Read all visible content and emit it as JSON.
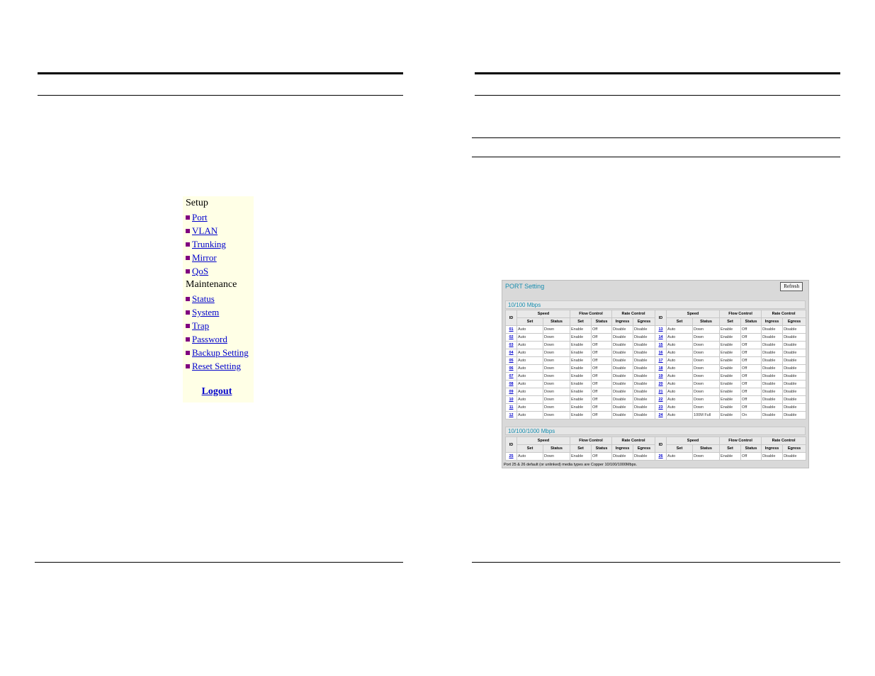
{
  "sidebar": {
    "setup_heading": "Setup",
    "setup_items": [
      {
        "label": "Port"
      },
      {
        "label": "VLAN"
      },
      {
        "label": "Trunking"
      },
      {
        "label": "Mirror"
      },
      {
        "label": "QoS"
      }
    ],
    "maintenance_heading": "Maintenance",
    "maintenance_items": [
      {
        "label": "Status"
      },
      {
        "label": "System"
      },
      {
        "label": "Trap"
      },
      {
        "label": "Password"
      },
      {
        "label": "Backup Setting"
      },
      {
        "label": "Reset Setting"
      }
    ],
    "logout_label": "Logout",
    "bullet_color": "#800080",
    "link_color": "#0000cc",
    "background_color": "#ffffe6"
  },
  "port_setting": {
    "title": "PORT Setting",
    "refresh_label": "Refresh",
    "section_fast": "10/100 Mbps",
    "section_giga": "10/100/1000 Mbps",
    "headers": {
      "id": "ID",
      "speed": "Speed",
      "flow_control": "Flow Control",
      "rate_control": "Rate Control",
      "set": "Set",
      "status": "Status",
      "ingress": "Ingress",
      "egress": "Egress"
    },
    "fast_rows": [
      [
        {
          "id": "01",
          "speed_set": "Auto",
          "speed_status": "Down",
          "flow_set": "Enable",
          "flow_status": "Off",
          "ingress": "Disable",
          "egress": "Disable"
        },
        {
          "id": "13",
          "speed_set": "Auto",
          "speed_status": "Down",
          "flow_set": "Enable",
          "flow_status": "Off",
          "ingress": "Disable",
          "egress": "Disable"
        }
      ],
      [
        {
          "id": "02",
          "speed_set": "Auto",
          "speed_status": "Down",
          "flow_set": "Enable",
          "flow_status": "Off",
          "ingress": "Disable",
          "egress": "Disable"
        },
        {
          "id": "14",
          "speed_set": "Auto",
          "speed_status": "Down",
          "flow_set": "Enable",
          "flow_status": "Off",
          "ingress": "Disable",
          "egress": "Disable"
        }
      ],
      [
        {
          "id": "03",
          "speed_set": "Auto",
          "speed_status": "Down",
          "flow_set": "Enable",
          "flow_status": "Off",
          "ingress": "Disable",
          "egress": "Disable"
        },
        {
          "id": "15",
          "speed_set": "Auto",
          "speed_status": "Down",
          "flow_set": "Enable",
          "flow_status": "Off",
          "ingress": "Disable",
          "egress": "Disable"
        }
      ],
      [
        {
          "id": "04",
          "speed_set": "Auto",
          "speed_status": "Down",
          "flow_set": "Enable",
          "flow_status": "Off",
          "ingress": "Disable",
          "egress": "Disable"
        },
        {
          "id": "16",
          "speed_set": "Auto",
          "speed_status": "Down",
          "flow_set": "Enable",
          "flow_status": "Off",
          "ingress": "Disable",
          "egress": "Disable"
        }
      ],
      [
        {
          "id": "05",
          "speed_set": "Auto",
          "speed_status": "Down",
          "flow_set": "Enable",
          "flow_status": "Off",
          "ingress": "Disable",
          "egress": "Disable"
        },
        {
          "id": "17",
          "speed_set": "Auto",
          "speed_status": "Down",
          "flow_set": "Enable",
          "flow_status": "Off",
          "ingress": "Disable",
          "egress": "Disable"
        }
      ],
      [
        {
          "id": "06",
          "speed_set": "Auto",
          "speed_status": "Down",
          "flow_set": "Enable",
          "flow_status": "Off",
          "ingress": "Disable",
          "egress": "Disable"
        },
        {
          "id": "18",
          "speed_set": "Auto",
          "speed_status": "Down",
          "flow_set": "Enable",
          "flow_status": "Off",
          "ingress": "Disable",
          "egress": "Disable"
        }
      ],
      [
        {
          "id": "07",
          "speed_set": "Auto",
          "speed_status": "Down",
          "flow_set": "Enable",
          "flow_status": "Off",
          "ingress": "Disable",
          "egress": "Disable"
        },
        {
          "id": "19",
          "speed_set": "Auto",
          "speed_status": "Down",
          "flow_set": "Enable",
          "flow_status": "Off",
          "ingress": "Disable",
          "egress": "Disable"
        }
      ],
      [
        {
          "id": "08",
          "speed_set": "Auto",
          "speed_status": "Down",
          "flow_set": "Enable",
          "flow_status": "Off",
          "ingress": "Disable",
          "egress": "Disable"
        },
        {
          "id": "20",
          "speed_set": "Auto",
          "speed_status": "Down",
          "flow_set": "Enable",
          "flow_status": "Off",
          "ingress": "Disable",
          "egress": "Disable"
        }
      ],
      [
        {
          "id": "09",
          "speed_set": "Auto",
          "speed_status": "Down",
          "flow_set": "Enable",
          "flow_status": "Off",
          "ingress": "Disable",
          "egress": "Disable"
        },
        {
          "id": "21",
          "speed_set": "Auto",
          "speed_status": "Down",
          "flow_set": "Enable",
          "flow_status": "Off",
          "ingress": "Disable",
          "egress": "Disable"
        }
      ],
      [
        {
          "id": "10",
          "speed_set": "Auto",
          "speed_status": "Down",
          "flow_set": "Enable",
          "flow_status": "Off",
          "ingress": "Disable",
          "egress": "Disable"
        },
        {
          "id": "22",
          "speed_set": "Auto",
          "speed_status": "Down",
          "flow_set": "Enable",
          "flow_status": "Off",
          "ingress": "Disable",
          "egress": "Disable"
        }
      ],
      [
        {
          "id": "11",
          "speed_set": "Auto",
          "speed_status": "Down",
          "flow_set": "Enable",
          "flow_status": "Off",
          "ingress": "Disable",
          "egress": "Disable"
        },
        {
          "id": "23",
          "speed_set": "Auto",
          "speed_status": "Down",
          "flow_set": "Enable",
          "flow_status": "Off",
          "ingress": "Disable",
          "egress": "Disable"
        }
      ],
      [
        {
          "id": "12",
          "speed_set": "Auto",
          "speed_status": "Down",
          "flow_set": "Enable",
          "flow_status": "Off",
          "ingress": "Disable",
          "egress": "Disable"
        },
        {
          "id": "24",
          "speed_set": "Auto",
          "speed_status": "100M Full",
          "flow_set": "Enable",
          "flow_status": "On",
          "ingress": "Disable",
          "egress": "Disable"
        }
      ]
    ],
    "giga_rows": [
      [
        {
          "id": "25",
          "speed_set": "Auto",
          "speed_status": "Down",
          "flow_set": "Enable",
          "flow_status": "Off",
          "ingress": "Disable",
          "egress": "Disable"
        },
        {
          "id": "26",
          "speed_set": "Auto",
          "speed_status": "Down",
          "flow_set": "Enable",
          "flow_status": "Off",
          "ingress": "Disable",
          "egress": "Disable"
        }
      ]
    ],
    "note": "Port 25 & 26 default (or unlinked) media types are Copper 10/100/1000Mbps.",
    "title_color": "#1a8fb0",
    "panel_color": "#d9d9d9"
  }
}
